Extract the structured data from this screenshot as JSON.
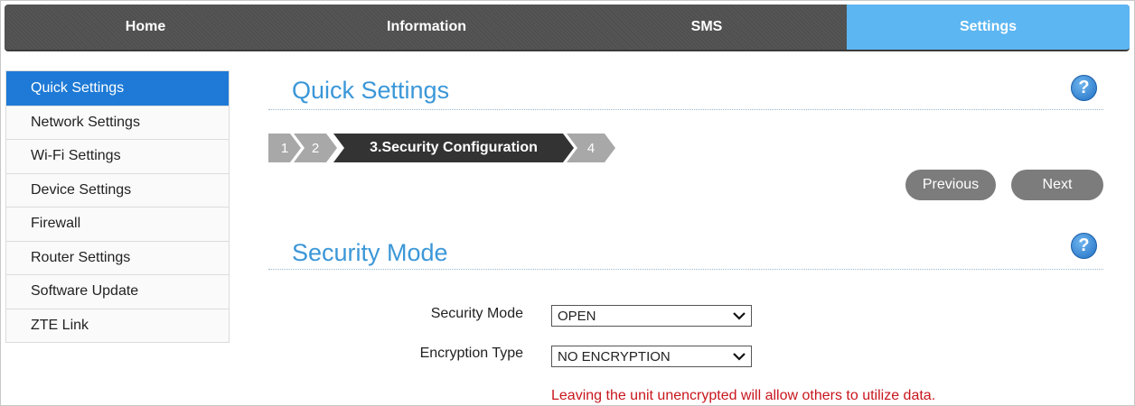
{
  "nav": {
    "tabs": [
      {
        "label": "Home"
      },
      {
        "label": "Information"
      },
      {
        "label": "SMS"
      },
      {
        "label": "Settings"
      }
    ],
    "active": "Settings"
  },
  "sidebar": {
    "items": [
      {
        "label": "Quick Settings"
      },
      {
        "label": "Network Settings"
      },
      {
        "label": "Wi-Fi Settings"
      },
      {
        "label": "Device Settings"
      },
      {
        "label": "Firewall"
      },
      {
        "label": "Router Settings"
      },
      {
        "label": "Software Update"
      },
      {
        "label": "ZTE Link"
      }
    ],
    "active": "Quick Settings"
  },
  "quick_settings": {
    "title": "Quick Settings",
    "help_icon": "?",
    "steps": [
      {
        "label": "1"
      },
      {
        "label": "2"
      },
      {
        "label": "3.Security Configuration"
      },
      {
        "label": "4"
      }
    ],
    "active_step": 3,
    "previous_label": "Previous",
    "next_label": "Next"
  },
  "security": {
    "title": "Security Mode",
    "help_icon": "?",
    "mode_label": "Security Mode",
    "mode_value": "OPEN",
    "encryption_label": "Encryption Type",
    "encryption_value": "NO ENCRYPTION",
    "warning": "Leaving the unit unencrypted will allow others to utilize data."
  },
  "colors": {
    "accent": "#5cb6f2",
    "sidebar_active": "#1e7ad6",
    "heading": "#3b97d8",
    "warning": "#c8161d"
  }
}
